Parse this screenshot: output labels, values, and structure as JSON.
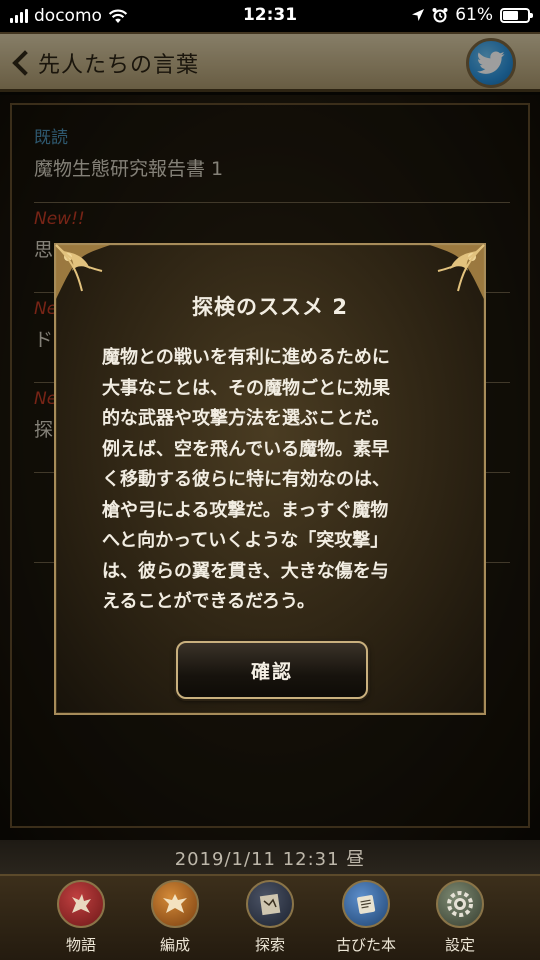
{
  "status_bar": {
    "carrier": "docomo",
    "time": "12:31",
    "battery_percent": "61%",
    "battery_level": 0.61,
    "icons": [
      "signal-icon",
      "wifi-icon",
      "location-icon",
      "alarm-icon",
      "battery-icon"
    ]
  },
  "header": {
    "title": "先人たちの言葉",
    "back_icon": "chevron-left-icon",
    "share_icon": "twitter-icon",
    "share_color": "#2a8fd8"
  },
  "list": {
    "items": [
      {
        "status": "既読",
        "title": "魔物生態研究報告書 1"
      },
      {
        "status": "New!!",
        "title": "思"
      },
      {
        "status": "Ne",
        "title": "ド"
      },
      {
        "status": "Ne",
        "title": "探"
      }
    ]
  },
  "modal": {
    "title": "探検のススメ 2",
    "lines": [
      "魔物との戦いを有利に進めるために",
      "大事なことは、その魔物ごとに効果",
      "的な武器や攻撃方法を選ぶことだ。",
      "例えば、空を飛んでいる魔物。素早",
      "く移動する彼らに特に有効なのは、",
      "槍や弓による攻撃だ。まっすぐ魔物",
      "へと向かっていくような「突攻撃」",
      "は、彼らの翼を貫き、大きな傷を与",
      "えることができるだろう。"
    ],
    "confirm_label": "確認"
  },
  "date_bar": {
    "text": "2019/1/11  12:31 昼"
  },
  "tabs": [
    {
      "label": "物語",
      "icon": "griffin-emblem-icon",
      "color": "#8e2424"
    },
    {
      "label": "編成",
      "icon": "eagle-emblem-icon",
      "color": "#a9641c"
    },
    {
      "label": "探索",
      "icon": "map-scroll-icon",
      "color": "#2b3240"
    },
    {
      "label": "古びた本",
      "icon": "old-book-icon",
      "color": "#2f5f96"
    },
    {
      "label": "設定",
      "icon": "gear-icon",
      "color": "#5a6650"
    }
  ]
}
